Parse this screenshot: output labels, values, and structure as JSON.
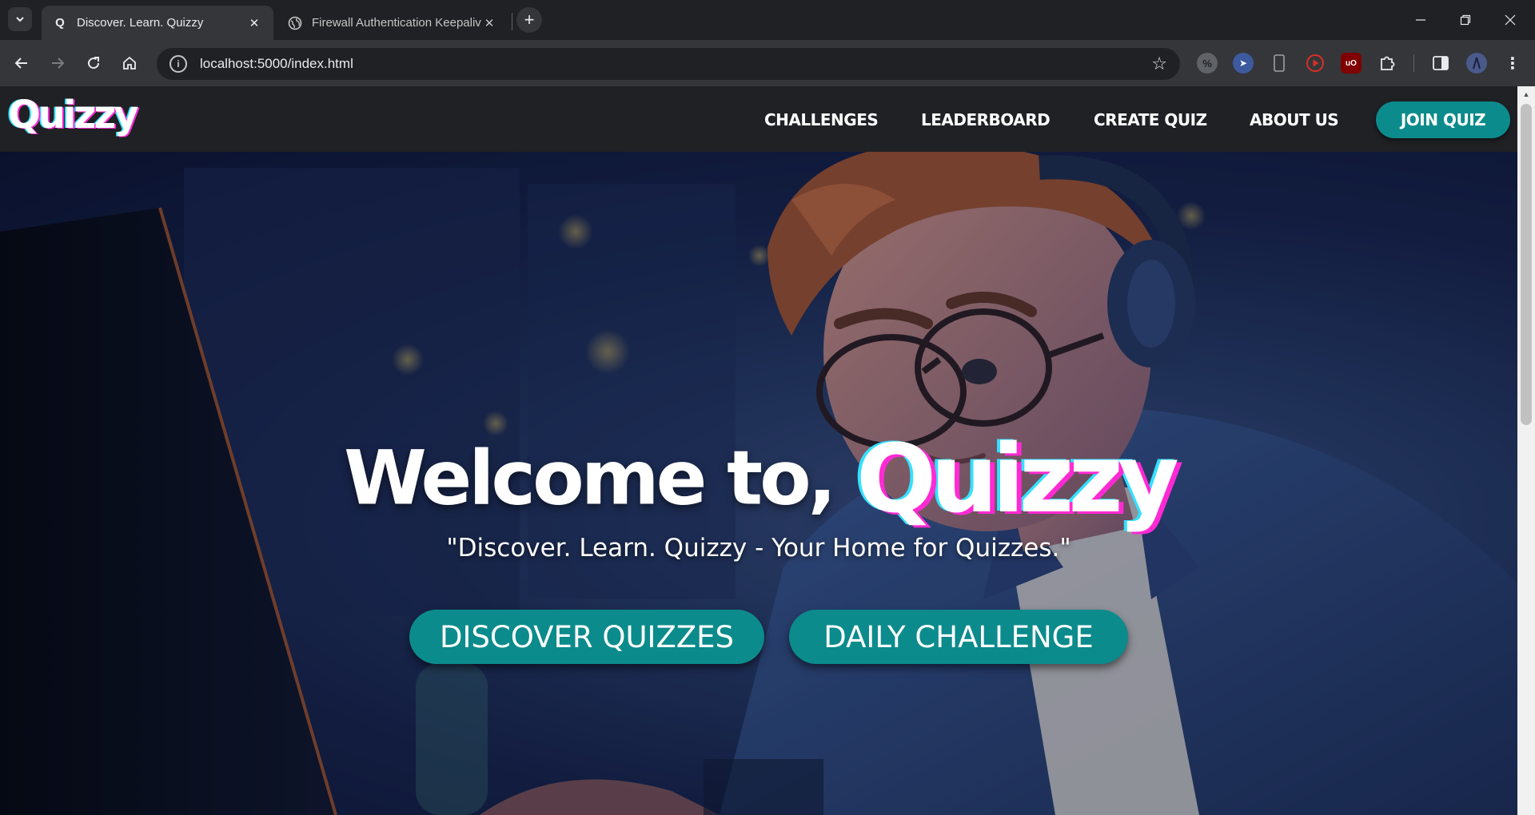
{
  "browser": {
    "tabs": [
      {
        "title": "Discover. Learn. Quizzy",
        "favicon": "Q",
        "active": true
      },
      {
        "title": "Firewall Authentication Keepalive",
        "favicon": "globe-icon",
        "active": false
      }
    ],
    "url": "localhost:5000/index.html"
  },
  "site": {
    "logo": "Quizzy",
    "nav": [
      "CHALLENGES",
      "LEADERBOARD",
      "CREATE QUIZ",
      "ABOUT US"
    ],
    "join_label": "JOIN QUIZ"
  },
  "hero": {
    "welcome": "Welcome to,",
    "brand": "Quizzy",
    "tagline": "\"Discover. Learn. Quizzy - Your Home for Quizzes.\"",
    "buttons": [
      "DISCOVER QUIZZES",
      "DAILY CHALLENGE"
    ]
  },
  "colors": {
    "accent": "#0c8b8c",
    "glitch_pink": "#ff2ad4",
    "glitch_cyan": "#33e0ff",
    "chrome_dark": "#202124",
    "chrome_mid": "#35363a"
  }
}
